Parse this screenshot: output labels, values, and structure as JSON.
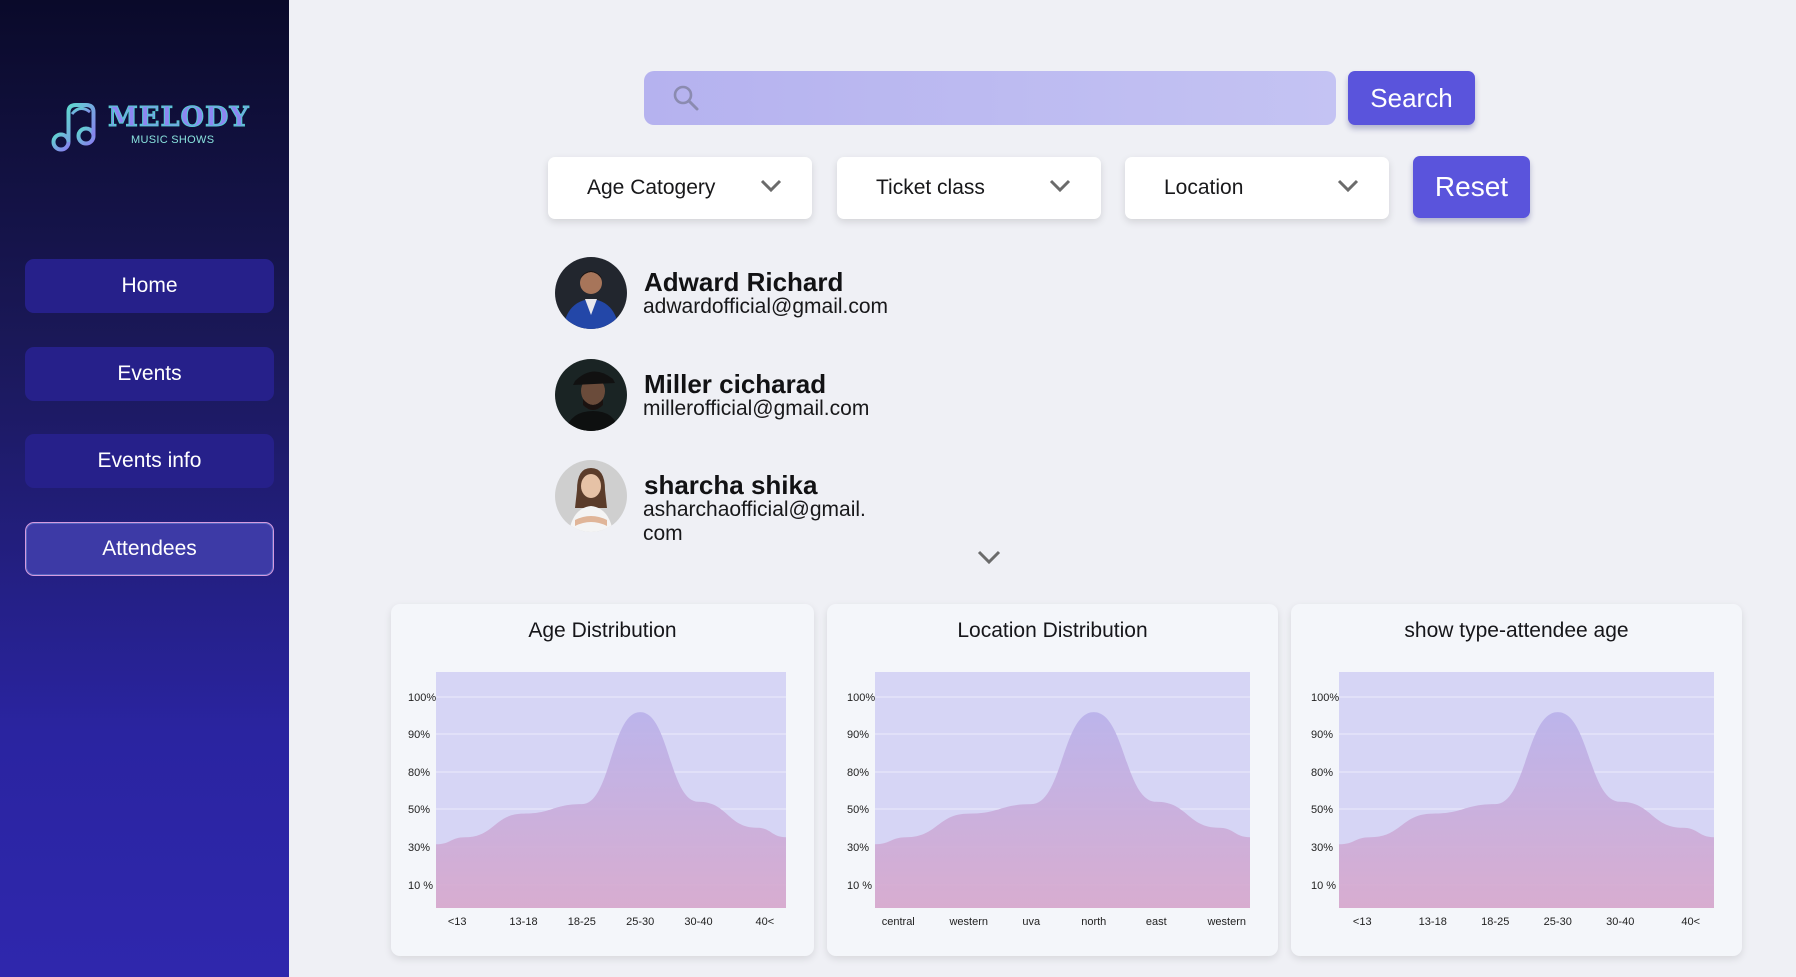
{
  "app": {
    "logo_title": "MELODY",
    "logo_subtitle": "MUSIC SHOWS"
  },
  "sidebar": {
    "items": [
      {
        "label": "Home"
      },
      {
        "label": "Events"
      },
      {
        "label": "Events info"
      },
      {
        "label": "Attendees",
        "active": true
      }
    ]
  },
  "search": {
    "placeholder": "",
    "value": "",
    "button_label": "Search"
  },
  "filters": {
    "age": "Age Catogery",
    "ticket": "Ticket class",
    "location": "Location",
    "reset_label": "Reset"
  },
  "attendees": [
    {
      "name": "Adward Richard",
      "email": "adwardofficial@gmail.com"
    },
    {
      "name": "Miller cicharad",
      "email": "millerofficial@gmail.com"
    },
    {
      "name": "sharcha shika",
      "email": "asharchaofficial@gmail.\ncom"
    }
  ],
  "icons": {
    "search": "search-icon",
    "dropdown": "chevron-down-icon",
    "logo": "music-note-icon"
  },
  "colors": {
    "accent": "#5a54dc",
    "sidebar_top": "#0a0a2a",
    "sidebar_bottom": "#2f27ad",
    "chart_fill_top": "#b9b1ea",
    "chart_fill_bottom": "#d8a8cc",
    "chart_bg": "#d6d5f5"
  },
  "chart_data": [
    {
      "type": "area",
      "title": "Age Distribution",
      "categories": [
        "<13",
        "13-18",
        "18-25",
        "25-30",
        "30-40",
        "40<"
      ],
      "y_ticks": [
        "100%",
        "90%",
        "80%",
        "50%",
        "30%",
        "10 %"
      ],
      "values": [
        30,
        40,
        44,
        83,
        45,
        34
      ]
    },
    {
      "type": "area",
      "title": "Location Distribution",
      "categories": [
        "central",
        "western",
        "uva",
        "north",
        "east",
        "western"
      ],
      "y_ticks": [
        "100%",
        "90%",
        "80%",
        "50%",
        "30%",
        "10 %"
      ],
      "values": [
        30,
        40,
        44,
        83,
        45,
        34
      ]
    },
    {
      "type": "area",
      "title": "show type-attendee age",
      "categories": [
        "<13",
        "13-18",
        "18-25",
        "25-30",
        "30-40",
        "40<"
      ],
      "y_ticks": [
        "100%",
        "90%",
        "80%",
        "50%",
        "30%",
        "10 %"
      ],
      "values": [
        30,
        40,
        44,
        83,
        45,
        34
      ]
    }
  ]
}
